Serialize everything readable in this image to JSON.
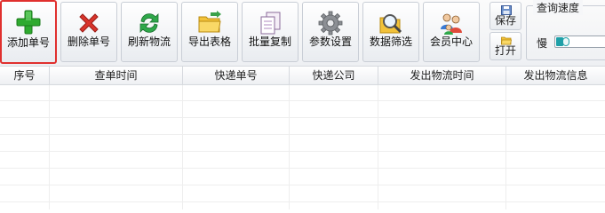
{
  "toolbar": {
    "buttons": [
      {
        "label": "添加单号",
        "icon": "plus-icon"
      },
      {
        "label": "删除单号",
        "icon": "delete-x-icon"
      },
      {
        "label": "刷新物流",
        "icon": "refresh-icon"
      },
      {
        "label": "导出表格",
        "icon": "folder-export-icon"
      },
      {
        "label": "批量复制",
        "icon": "copy-documents-icon"
      },
      {
        "label": "参数设置",
        "icon": "gear-icon"
      },
      {
        "label": "数据筛选",
        "icon": "search-folder-icon"
      },
      {
        "label": "会员中心",
        "icon": "users-icon"
      }
    ],
    "save_label": "保存",
    "open_label": "打开"
  },
  "speed": {
    "title": "查询速度",
    "slow_label": "慢",
    "level": 0.15
  },
  "table": {
    "columns": [
      "序号",
      "查单时间",
      "快递单号",
      "快递公司",
      "发出物流时间",
      "发出物流信息"
    ],
    "rows": []
  },
  "colors": {
    "active_border": "#e0302e",
    "slider_fill": "#1fa0a8",
    "plus_green": "#2faa2f",
    "delete_red": "#d9342b"
  }
}
